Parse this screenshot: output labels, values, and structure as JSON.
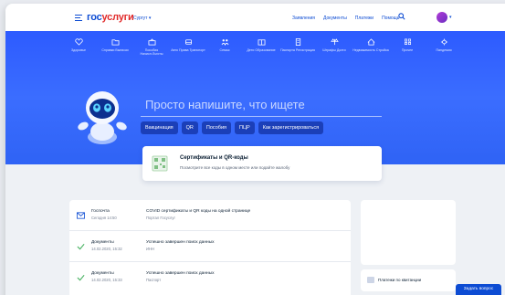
{
  "header": {
    "logo_part1": "гос",
    "logo_part2": "услуги",
    "region": "Сургут",
    "nav": [
      "Заявления",
      "Документы",
      "Платежи",
      "Помощь"
    ]
  },
  "categories": [
    {
      "label": "Здоровье",
      "icon": "heart-icon"
    },
    {
      "label": "Справки Выписки",
      "icon": "folder-icon"
    },
    {
      "label": "Пособия Начисл.Льготы",
      "icon": "wallet-icon"
    },
    {
      "label": "Авто Права Транспорт",
      "icon": "car-icon"
    },
    {
      "label": "Семья",
      "icon": "family-icon"
    },
    {
      "label": "Дети Образование",
      "icon": "book-icon"
    },
    {
      "label": "Паспорта Регистрация",
      "icon": "passport-icon"
    },
    {
      "label": "Штрафы Долги",
      "icon": "scales-icon"
    },
    {
      "label": "Недвижимость Стройка",
      "icon": "house-icon"
    },
    {
      "label": "Прочее",
      "icon": "grid-icon"
    },
    {
      "label": "Пандемия",
      "icon": "virus-icon"
    }
  ],
  "hero": {
    "search_placeholder": "Просто напишите, что ищете",
    "chips": [
      "Вакцинация",
      "QR",
      "Пособия",
      "ПЦР",
      "Как зарегистрироваться"
    ]
  },
  "cert_card": {
    "title": "Сертификаты и QR-коды",
    "subtitle": "Посмотрите все коды в одном месте или подайте жалобу"
  },
  "feed": [
    {
      "type": "Госпочта",
      "date": "Сегодня 14:50",
      "message": "COVID сертификаты и QR коды на одной странице",
      "source": "Портал Госуслуг",
      "icon": "mail-icon"
    },
    {
      "type": "Документы",
      "date": "14.02.2020, 15:32",
      "message": "Успешно завершен поиск данных",
      "source": "ИНН",
      "icon": "check-icon"
    },
    {
      "type": "Документы",
      "date": "14.02.2020, 15:33",
      "message": "Успешно завершен поиск данных",
      "source": "Паспорт",
      "icon": "check-icon"
    }
  ],
  "side": {
    "receipt_label": "Платежи по квитанции"
  },
  "ask_button": "Задать вопрос",
  "colors": {
    "brand_blue": "#0d4cd3",
    "brand_red": "#e12a2a",
    "hero_blue": "#3b6dff"
  }
}
